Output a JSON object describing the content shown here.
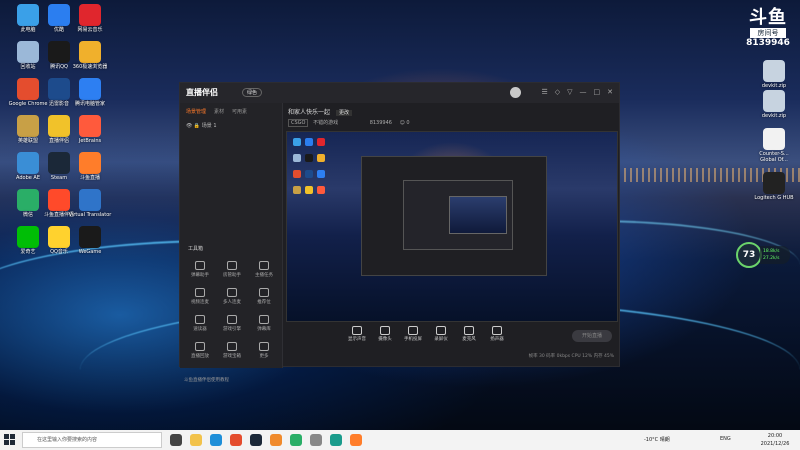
{
  "desktop_left_icons": [
    {
      "label": "此电脑",
      "color": "#3aa0e8"
    },
    {
      "label": "优酷",
      "color": "#2b7ef0"
    },
    {
      "label": "网易云音乐",
      "color": "#e0262d"
    },
    {
      "label": "回收站",
      "color": "#9bb8d8"
    },
    {
      "label": "腾讯QQ",
      "color": "#1a1a1a"
    },
    {
      "label": "360极速浏览器",
      "color": "#f0b02c"
    },
    {
      "label": "Google Chrome",
      "color": "#e44d2e"
    },
    {
      "label": "迅雷影音",
      "color": "#1d4b8c"
    },
    {
      "label": "腾讯电脑管家",
      "color": "#2d7ff2"
    },
    {
      "label": "英雄联盟",
      "color": "#c8a046"
    },
    {
      "label": "直播伴侣",
      "color": "#f1c22a"
    },
    {
      "label": "JetBrains",
      "color": "#ff5a3c"
    },
    {
      "label": "Adobe AE",
      "color": "#3a8ed6"
    },
    {
      "label": "Steam",
      "color": "#1b2838"
    },
    {
      "label": "斗鱼直播",
      "color": "#ff7d2a"
    },
    {
      "label": "微信",
      "color": "#2aae67"
    },
    {
      "label": "斗鱼直播伴侣",
      "color": "#ff4a2a"
    },
    {
      "label": "Virtual Translator",
      "color": "#2f74c9"
    },
    {
      "label": "爱奇艺",
      "color": "#00be06"
    },
    {
      "label": "QQ音乐",
      "color": "#ffd22e"
    },
    {
      "label": "WeGame",
      "color": "#1a1a1a"
    }
  ],
  "desktop_right_icons": [
    {
      "label": "devkit.zip",
      "color": "#c7d3e0"
    },
    {
      "label": "devkit.zip",
      "color": "#c7d3e0"
    },
    {
      "label": "Counter-S... Global Of...",
      "color": "#f2f2f2"
    },
    {
      "label": "Logitech G HUB",
      "color": "#222222"
    }
  ],
  "stream_overlay": {
    "logo": "斗鱼",
    "room_label": "房间号",
    "room_number": "8139946"
  },
  "app": {
    "logo_text": "直播伴侣",
    "version_badge": "绿色",
    "window_buttons": [
      "☰",
      "◇",
      "▽",
      "—",
      "□",
      "✕"
    ],
    "left_tabs": [
      "场景管理",
      "素材",
      "可用素"
    ],
    "scene_name": "场景 1",
    "tools_title": "工具箱",
    "tools": [
      "弹幕助手",
      "房管助手",
      "主播任务",
      "视频连麦",
      "多人连麦",
      "推荐位",
      "速读器",
      "游戏引擎",
      "弹幕库",
      "直播回放",
      "游戏宝箱",
      "更多"
    ],
    "notice": "斗鱼直播伴侣使用教程",
    "stream_title": "和家人快乐一起",
    "title_badge": "更改",
    "category": "CSGO",
    "category_sub": "不错的游戏",
    "room_id": "8139946",
    "viewer_count": "0",
    "bottom_buttons": [
      "显示声音",
      "摄像头",
      "手机投屏",
      "录屏仪",
      "麦克风",
      "扬声器"
    ],
    "go_live_label": "开始直播",
    "status_text": "帧率 30  码率 0kbps  CPU 12%  内存 45%"
  },
  "gauge": {
    "value": "73",
    "up": "18.8k/s",
    "down": "27.2k/s",
    "ring_color": "#6bd36b"
  },
  "taskbar": {
    "search_placeholder": "在这里输入你要搜索的内容",
    "weather": "-10°C 晴朗",
    "lang": "ENG",
    "time": "20:00",
    "date": "2021/12/26",
    "apps": [
      {
        "name": "task-view-icon",
        "color": "#444444"
      },
      {
        "name": "file-explorer-icon",
        "color": "#f2c24b"
      },
      {
        "name": "edge-icon",
        "color": "#1f8fd8"
      },
      {
        "name": "chrome-icon",
        "color": "#e44d2e"
      },
      {
        "name": "steam-icon",
        "color": "#1b2838"
      },
      {
        "name": "app-orange-icon",
        "color": "#f08a2c"
      },
      {
        "name": "wechat-icon",
        "color": "#2aae67"
      },
      {
        "name": "app-gray-icon",
        "color": "#888888"
      },
      {
        "name": "app-teal-icon",
        "color": "#1a9c8c"
      },
      {
        "name": "douyu-icon",
        "color": "#ff7d2a"
      }
    ]
  }
}
